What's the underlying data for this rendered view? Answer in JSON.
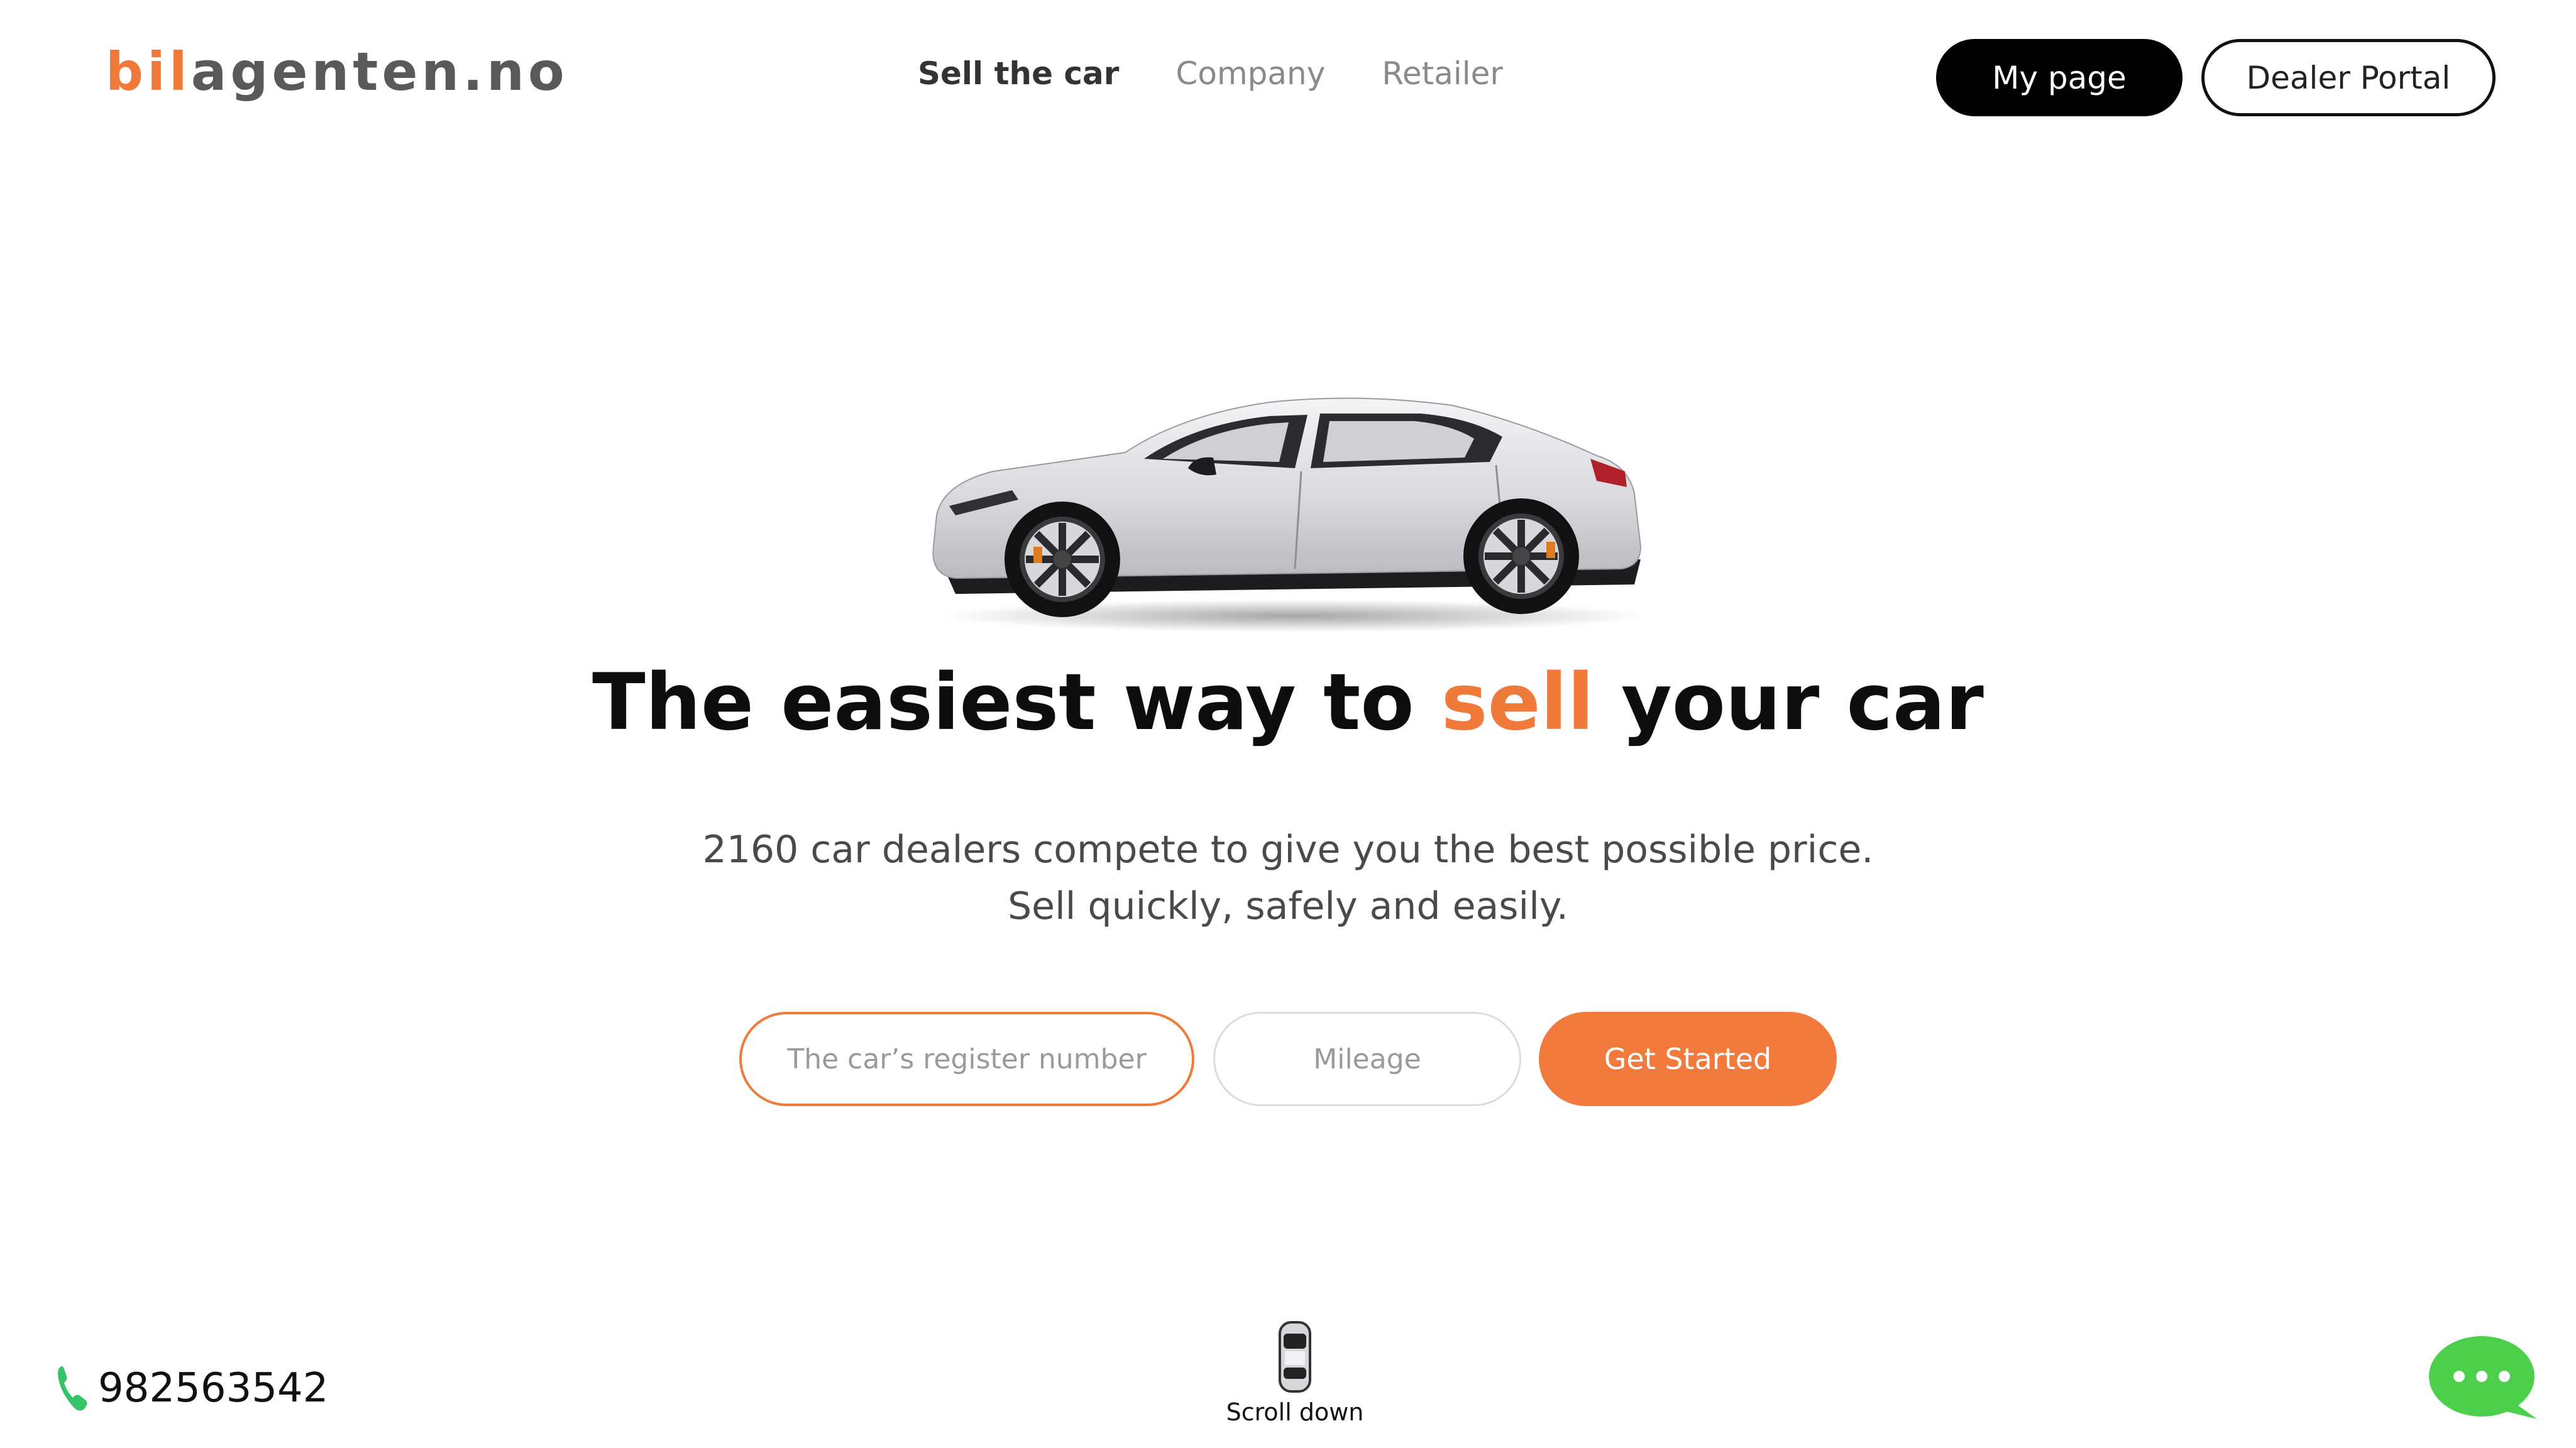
{
  "brand": {
    "logo_part1": "bil",
    "logo_part2": "agenten.no",
    "accent_color": "#f07a3a"
  },
  "nav": {
    "items": [
      {
        "label": "Sell the car",
        "active": true
      },
      {
        "label": "Company",
        "active": false
      },
      {
        "label": "Retailer",
        "active": false
      }
    ]
  },
  "header_buttons": {
    "my_page": "My page",
    "dealer_portal": "Dealer Portal"
  },
  "hero": {
    "title_part1": "The easiest way to ",
    "title_accent": "sell",
    "title_part2": " your car",
    "subtitle_line1": "2160 car dealers compete to give you the best possible price.",
    "subtitle_line2": "Sell quickly, safely and easily."
  },
  "form": {
    "register_placeholder": "The car’s register number",
    "mileage_placeholder": "Mileage",
    "submit_label": "Get Started"
  },
  "footer": {
    "phone_number": "982563542",
    "scroll_label": "Scroll down"
  },
  "icons": {
    "phone": "phone-icon",
    "scroll": "car-top-view-icon",
    "chat": "chat-bubble-icon",
    "car": "car-image"
  },
  "colors": {
    "primary_button": "#000000",
    "cta_button": "#f27a3c",
    "chat_green": "#4cd04c",
    "phone_green": "#35c46a"
  }
}
